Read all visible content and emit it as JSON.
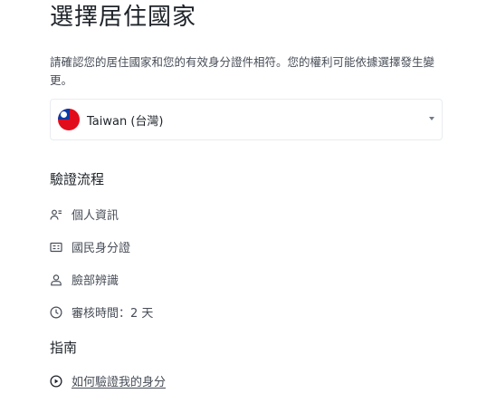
{
  "page": {
    "title": "選擇居住國家",
    "description": "請確認您的居住國家和您的有效身分證件相符。您的權利可能依據選擇發生變更。"
  },
  "country_select": {
    "selected": "Taiwan (台灣)",
    "flag_icon": "taiwan-flag-icon"
  },
  "verification": {
    "heading": "驗證流程",
    "steps": [
      {
        "label": "個人資訊",
        "icon": "person-info-icon"
      },
      {
        "label": "國民身分證",
        "icon": "id-card-icon"
      },
      {
        "label": "臉部辨識",
        "icon": "face-person-icon"
      },
      {
        "label": "審核時間：2 天",
        "icon": "clock-icon"
      }
    ]
  },
  "guide": {
    "heading": "指南",
    "link_label": "如何驗證我的身分",
    "link_icon": "play-circle-icon"
  },
  "colors": {
    "text_primary": "#1e2329",
    "text_secondary": "#474d57",
    "border": "#eaecef"
  }
}
